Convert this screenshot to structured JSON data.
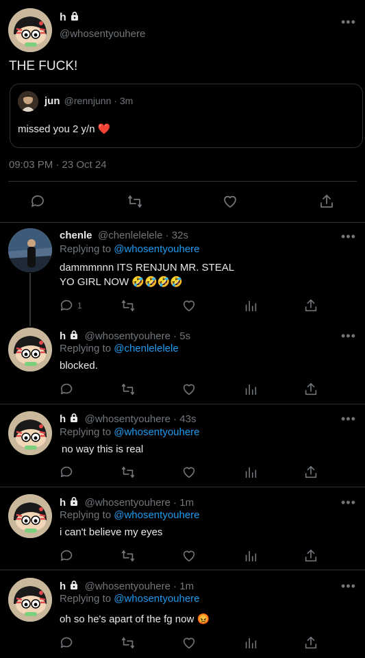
{
  "main_tweet": {
    "name": "h",
    "handle": "@whosentyouhere",
    "text": "THE FUCK!",
    "quote": {
      "name": "jun",
      "handle_time": "@rennjunn · 3m",
      "text": "missed you 2 y/n ❤️"
    },
    "timestamp": "09:03 PM · 23 Oct 24",
    "more": "•••"
  },
  "replies": [
    {
      "name": "chenle",
      "meta": "@chenlelelele · 32s",
      "replying_prefix": "Replying to ",
      "replying_to": "@whosentyouhere",
      "text_line1": "dammmnnn ITS RENJUN MR. STEAL",
      "text_line2": "YO GIRL NOW 🤣🤣🤣🤣",
      "reply_count": "1",
      "more": "•••"
    },
    {
      "name": "h",
      "meta": "@whosentyouhere · 5s",
      "replying_prefix": "Replying to ",
      "replying_to": "@chenlelelele",
      "text": "blocked.",
      "more": "•••"
    },
    {
      "name": "h",
      "meta": "@whosentyouhere · 43s",
      "replying_prefix": "Replying to ",
      "replying_to": "@whosentyouhere",
      "text": "no way this is real",
      "more": "•••"
    },
    {
      "name": "h",
      "meta": "@whosentyouhere · 1m",
      "replying_prefix": "Replying to ",
      "replying_to": "@whosentyouhere",
      "text": "i can't believe my eyes",
      "more": "•••"
    },
    {
      "name": "h",
      "meta": "@whosentyouhere · 1m",
      "replying_prefix": "Replying to ",
      "replying_to": "@whosentyouhere",
      "text": "oh so he's apart of the fg now 😡",
      "more": "•••"
    }
  ],
  "colors": {
    "background": "#000000",
    "link": "#1d9bf0",
    "muted": "#71767b",
    "divider": "#2f3336"
  }
}
